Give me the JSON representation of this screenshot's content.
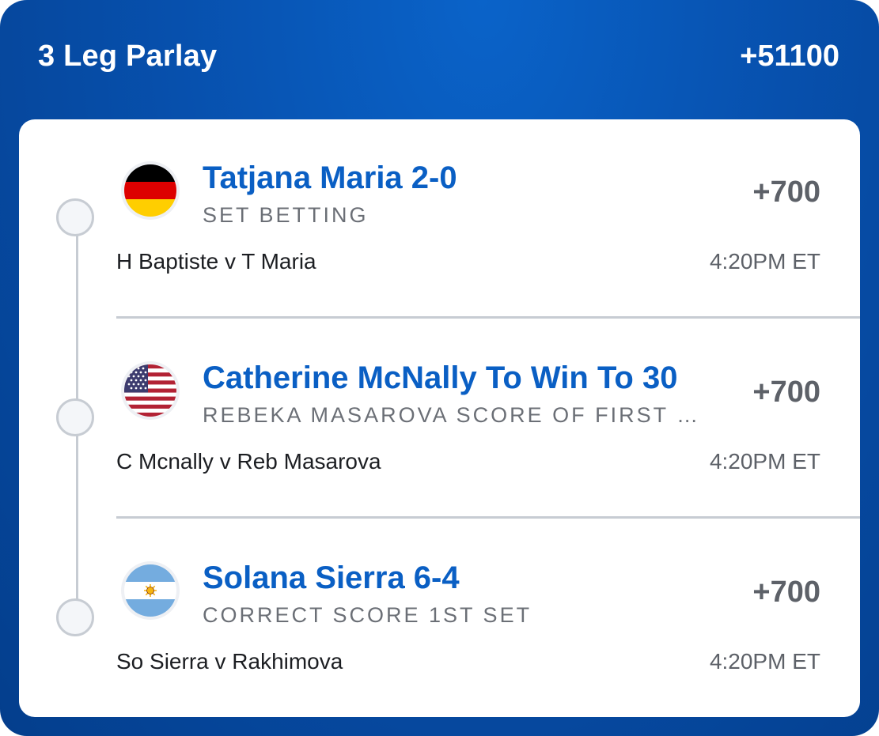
{
  "parlay": {
    "title": "3 Leg Parlay",
    "odds": "+51100"
  },
  "legs": [
    {
      "flag": "germany-flag",
      "selection": "Tatjana Maria 2-0",
      "market": "SET BETTING",
      "odds": "+700",
      "matchup": "H Baptiste v T Maria",
      "time": "4:20PM ET"
    },
    {
      "flag": "usa-flag",
      "selection": "Catherine McNally To Win To 30",
      "market": "REBEKA MASAROVA SCORE OF FIRST SER...",
      "odds": "+700",
      "matchup": "C Mcnally v Reb Masarova",
      "time": "4:20PM ET"
    },
    {
      "flag": "argentina-flag",
      "selection": "Solana Sierra 6-4",
      "market": "CORRECT SCORE 1ST SET",
      "odds": "+700",
      "matchup": "So Sierra v Rakhimova",
      "time": "4:20PM ET"
    }
  ],
  "colors": {
    "header_blue": "#0750ad",
    "selection_blue": "#0a5fc4",
    "timeline_gray": "#c7ccd3"
  }
}
